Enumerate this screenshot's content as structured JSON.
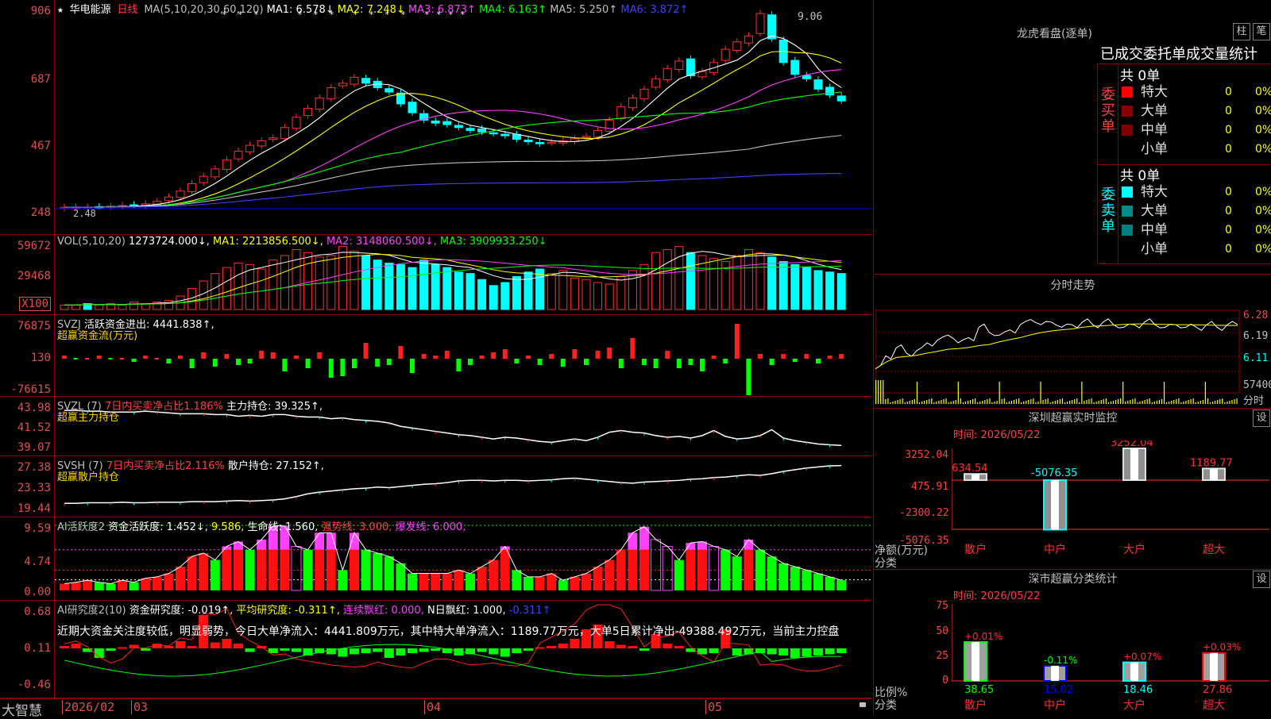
{
  "stock": {
    "star": "★",
    "name": "华电能源",
    "period": "日线"
  },
  "kline": {
    "ticks": [
      "906",
      "687",
      "467",
      "248"
    ],
    "ma_header": [
      {
        "t": "MA(5,10,20,30,60,120)",
        "c": "#c0c0c0"
      },
      {
        "t": "MA1: 6.578↓",
        "c": "#ffffff"
      },
      {
        "t": "MA2: 7.248↓",
        "c": "#ffff00"
      },
      {
        "t": "MA3: 6.873↑",
        "c": "#ff40ff"
      },
      {
        "t": "MA4: 6.163↑",
        "c": "#00ff00"
      },
      {
        "t": "MA5: 5.250↑",
        "c": "#c0c0c0"
      },
      {
        "t": "MA6: 3.872↑",
        "c": "#4040ff"
      }
    ],
    "high_label": "9.06",
    "low_label": "2.48",
    "closes": [
      2.5,
      2.51,
      2.5,
      2.52,
      2.54,
      2.56,
      2.58,
      2.62,
      2.7,
      2.85,
      3.05,
      3.3,
      3.55,
      3.8,
      4.1,
      4.4,
      4.6,
      4.75,
      4.85,
      5.2,
      5.55,
      5.85,
      6.2,
      6.55,
      6.7,
      6.9,
      6.7,
      6.55,
      6.4,
      6.0,
      5.7,
      5.45,
      5.35,
      5.3,
      5.2,
      5.1,
      5.05,
      5.0,
      4.92,
      4.8,
      4.72,
      4.65,
      4.7,
      4.75,
      4.82,
      4.9,
      5.1,
      5.45,
      5.9,
      6.2,
      6.5,
      6.85,
      7.2,
      7.45,
      6.95,
      7.1,
      7.4,
      7.85,
      8.1,
      8.3,
      9.06,
      8.2,
      7.4,
      7.0,
      6.85,
      6.5,
      6.3,
      6.1
    ]
  },
  "vol": {
    "ticks": [
      "59672",
      "29468",
      "X100"
    ],
    "header": [
      {
        "t": "VOL(5,10,20)",
        "c": "#c0c0c0"
      },
      {
        "t": "1273724.000↓,",
        "c": "#ffffff"
      },
      {
        "t": "MA1: 2213856.500↓,",
        "c": "#ffff00"
      },
      {
        "t": "MA2: 3148060.500↓,",
        "c": "#ff40ff"
      },
      {
        "t": "MA3: 3909933.250↓",
        "c": "#00ff00"
      }
    ],
    "values": [
      3,
      3,
      4,
      3,
      4,
      3,
      5,
      4,
      5,
      6,
      9,
      14,
      19,
      24,
      28,
      31,
      30,
      27,
      33,
      36,
      40,
      38,
      35,
      36,
      42,
      39,
      36,
      33,
      31,
      30,
      28,
      33,
      30,
      28,
      25,
      24,
      20,
      16,
      18,
      22,
      25,
      27,
      24,
      26,
      21,
      20,
      18,
      17,
      22,
      26,
      30,
      38,
      40,
      42,
      38,
      36,
      34,
      32,
      36,
      40,
      38,
      35,
      32,
      30,
      28,
      26,
      25,
      24
    ]
  },
  "svzj": {
    "ticks": [
      "76875",
      "130",
      "-76615"
    ],
    "header": [
      {
        "t": "SVZJ",
        "c": "#c0c0c0"
      },
      {
        "t": "活跃资金进出: 4441.838↑,",
        "c": "#ffffff"
      }
    ],
    "label2": "超赢资金流(万元)",
    "values": [
      2,
      -1,
      1,
      2,
      -1,
      1,
      -2,
      2,
      1,
      -3,
      2,
      -6,
      4,
      -5,
      3,
      -4,
      -3,
      5,
      4,
      -8,
      2,
      -6,
      4,
      -12,
      -11,
      -6,
      10,
      -5,
      -4,
      8,
      -9,
      3,
      2,
      5,
      -8,
      -4,
      2,
      4,
      6,
      -3,
      2,
      -4,
      3,
      -5,
      6,
      -4,
      5,
      7,
      -6,
      13,
      -4,
      -6,
      5,
      -6,
      -4,
      -8,
      2,
      -3,
      22,
      -24,
      3,
      -4,
      3,
      -2,
      3,
      -3,
      2,
      3
    ]
  },
  "svzl": {
    "ticks": [
      "43.98",
      "41.52",
      "39.07"
    ],
    "header": [
      {
        "t": "SVZL  (7)",
        "c": "#c0c0c0"
      },
      {
        "t": "7日内买卖净占比1.186%",
        "c": "#ff4040"
      },
      {
        "t": "主力持仓: 39.325↑,",
        "c": "#ffffff"
      }
    ],
    "label2": "超赢主力持仓",
    "values": [
      43.5,
      43.5,
      43.4,
      43.4,
      43.3,
      43.3,
      43.3,
      43.4,
      43.3,
      43.2,
      43.1,
      43.1,
      43.1,
      43.0,
      43.0,
      42.8,
      42.9,
      42.8,
      43.0,
      43.0,
      42.8,
      42.7,
      42.7,
      42.5,
      42.6,
      42.4,
      42.3,
      42.2,
      42.0,
      41.6,
      41.4,
      41.2,
      41.0,
      40.8,
      40.6,
      40.5,
      40.3,
      40.1,
      40.3,
      40.2,
      40.0,
      39.8,
      39.7,
      39.9,
      40.1,
      39.9,
      40.3,
      40.9,
      41.1,
      40.9,
      40.8,
      40.5,
      40.3,
      40.4,
      40.2,
      40.5,
      41.1,
      40.4,
      40.1,
      40.2,
      40.5,
      41.2,
      40.2,
      39.9,
      39.7,
      39.5,
      39.4,
      39.33
    ]
  },
  "svsh": {
    "ticks": [
      "27.38",
      "23.33",
      "19.44"
    ],
    "header": [
      {
        "t": "SVSH  (7)",
        "c": "#c0c0c0"
      },
      {
        "t": "7日内买卖净占比2.116%",
        "c": "#ff4040"
      },
      {
        "t": "散户持仓: 27.152↑,",
        "c": "#ffffff"
      }
    ],
    "label2": "超赢散户持仓",
    "values": [
      20.4,
      20.4,
      20.5,
      20.5,
      20.5,
      20.6,
      20.5,
      20.5,
      20.6,
      20.6,
      20.6,
      20.7,
      20.7,
      20.7,
      20.8,
      20.9,
      20.8,
      20.9,
      21.0,
      21.2,
      21.6,
      22.1,
      22.4,
      22.6,
      22.8,
      23.0,
      23.1,
      23.3,
      23.2,
      23.4,
      23.6,
      23.8,
      23.9,
      24.1,
      24.4,
      24.5,
      24.5,
      24.4,
      24.5,
      24.5,
      24.4,
      24.5,
      24.6,
      24.8,
      24.9,
      24.7,
      24.5,
      24.3,
      24.1,
      24.0,
      24.2,
      24.3,
      24.4,
      24.5,
      24.7,
      24.8,
      25.0,
      25.1,
      25.3,
      25.5,
      25.4,
      25.7,
      26.1,
      26.4,
      26.7,
      26.9,
      27.1,
      27.15
    ]
  },
  "ai1": {
    "ticks": [
      "9.59",
      "4.74",
      "0.00"
    ],
    "header": [
      {
        "t": "AI活跃度2",
        "c": "#c0c0c0"
      },
      {
        "t": "资金活跃度: 1.452↓,",
        "c": "#ffffff"
      },
      {
        "t": "9.586,",
        "c": "#ffff00"
      },
      {
        "t": "生命线: 1.560,",
        "c": "#ffffff"
      },
      {
        "t": "强势线: 3.000,",
        "c": "#ff4040"
      },
      {
        "t": "爆发线: 6.000,",
        "c": "#ff40ff"
      }
    ],
    "values": [
      1,
      1.2,
      1.5,
      1.2,
      1,
      1.5,
      1.2,
      1.8,
      2,
      2.5,
      3.5,
      5,
      5.5,
      4.5,
      6.5,
      7.2,
      6,
      7.5,
      9.5,
      9.5,
      6.5,
      6,
      8.5,
      8.5,
      3,
      8.5,
      6,
      5.5,
      5,
      4,
      2.5,
      2.5,
      2.5,
      2.5,
      3,
      2.5,
      3.5,
      4.5,
      6.5,
      3,
      2,
      2,
      2.5,
      1.5,
      2,
      2.5,
      3.5,
      4.5,
      6,
      8.5,
      9.4,
      7.5,
      6.5,
      4.5,
      7,
      7.2,
      6.5,
      6,
      5,
      7.5,
      6,
      5,
      4,
      3.5,
      3,
      2.5,
      2,
      1.5
    ]
  },
  "ai2": {
    "ticks": [
      "0.68",
      "0.11",
      "-0.46"
    ],
    "header": [
      {
        "t": "AI研究度2(10)",
        "c": "#c0c0c0"
      },
      {
        "t": "资金研究度: -0.019↑,",
        "c": "#ffffff"
      },
      {
        "t": "平均研究度: -0.311↑,",
        "c": "#ffff00"
      },
      {
        "t": "连续飘红: 0.000,",
        "c": "#ff40ff"
      },
      {
        "t": "N日飘红: 1.000,",
        "c": "#ffffff"
      },
      {
        "t": "-0.311↑",
        "c": "#4040ff"
      }
    ],
    "note": "近期大资金关注度较低，明显弱势，今日大单净流入：4441.809万元，其中特大单净流入：1189.77万元，大单5日累计净出-49388.492万元，当前主力控盘",
    "values": [
      0.02,
      0.04,
      -0.03,
      -0.08,
      -0.02,
      0.01,
      0.03,
      -0.02,
      0.04,
      0.02,
      0.06,
      0.02,
      0.28,
      0.05,
      0.08,
      0.04,
      -0.03,
      0.02,
      -0.04,
      -0.02,
      -0.03,
      -0.06,
      -0.04,
      -0.05,
      -0.07,
      -0.05,
      -0.04,
      -0.03,
      -0.08,
      -0.06,
      -0.04,
      -0.03,
      -0.02,
      -0.04,
      -0.06,
      -0.05,
      -0.03,
      -0.05,
      -0.07,
      -0.04,
      -0.02,
      0.01,
      0.02,
      0.04,
      0.08,
      0.16,
      0.2,
      0.06,
      0.03,
      0.02,
      -0.02,
      0.12,
      0.04,
      0.02,
      -0.03,
      -0.05,
      -0.04,
      0.16,
      -0.06,
      -0.05,
      -0.04,
      -0.05,
      -0.06,
      -0.08,
      -0.07,
      -0.06,
      -0.05,
      -0.04
    ]
  },
  "dates": {
    "year_month": "2026/02",
    "m1": "03",
    "m2": "04",
    "m3": "05"
  },
  "brand": "大智慧",
  "lhb": {
    "title": "龙虎看盘(逐单)",
    "btn1": "柱",
    "btn2": "笔",
    "subtitle": "已成交委托单成交量统计",
    "buy": {
      "label": "委买单",
      "total": "共 0单",
      "rows": [
        {
          "name": "特大",
          "a": "0",
          "b": "0%",
          "c": "#ff0000"
        },
        {
          "name": "大单",
          "a": "0",
          "b": "0%",
          "c": "#8b0000"
        },
        {
          "name": "中单",
          "a": "0",
          "b": "0%",
          "c": "#800000"
        },
        {
          "name": "小单",
          "a": "0",
          "b": "0%",
          "c": "#000000"
        }
      ]
    },
    "sell": {
      "label": "委卖单",
      "total": "共 0单",
      "rows": [
        {
          "name": "特大",
          "a": "0",
          "b": "0%",
          "c": "#00ffff"
        },
        {
          "name": "大单",
          "a": "0",
          "b": "0%",
          "c": "#008b8b"
        },
        {
          "name": "中单",
          "a": "0",
          "b": "0%",
          "c": "#008080"
        },
        {
          "name": "小单",
          "a": "0",
          "b": "0%",
          "c": "#000000"
        }
      ]
    }
  },
  "fenshi": {
    "title": "分时走势",
    "ticks": [
      "6.28",
      "6.19",
      "6.11"
    ],
    "vol_label": "57400",
    "vol_unit": "分时",
    "prices": [
      6.1,
      6.15,
      6.18,
      6.16,
      6.17,
      6.2,
      6.21,
      6.23,
      6.2,
      6.22,
      6.26,
      6.24,
      6.23,
      6.25,
      6.27,
      6.29,
      6.27,
      6.28,
      6.26,
      6.27,
      6.28,
      6.27,
      6.28,
      6.27,
      6.26,
      6.27,
      6.28,
      6.27,
      6.26,
      6.27,
      6.26,
      6.26,
      6.27,
      6.26,
      6.27,
      6.27
    ]
  },
  "monitor": {
    "title": "深圳超赢实时监控",
    "btn": "设",
    "time": "时间: 2026/05/22",
    "ticks": [
      "3252.04",
      "475.91",
      "-2300.22",
      "-5076.35"
    ],
    "ylabel": "净额(万元)",
    "xlabel": "分类",
    "cats": [
      {
        "name": "散户",
        "v": 634.54,
        "label": "634.54"
      },
      {
        "name": "中户",
        "v": -5076.35,
        "label": "-5076.35"
      },
      {
        "name": "大户",
        "v": 3252.04,
        "label": "3252.04"
      },
      {
        "name": "超大",
        "v": 1189.77,
        "label": "1189.77"
      }
    ]
  },
  "classify": {
    "title": "深市超赢分类统计",
    "btn": "设",
    "time": "时间: 2026/05/22",
    "ticks": [
      "75",
      "50",
      "25",
      "0"
    ],
    "ylabel": "比例%",
    "xlabel": "分类",
    "cats": [
      {
        "name": "散户",
        "v": 38.65,
        "pct": "+0.01%",
        "val": "38.65",
        "c": "#00ff00"
      },
      {
        "name": "中户",
        "v": 15.02,
        "pct": "-0.11%",
        "val": "15.02",
        "c": "#0000ff"
      },
      {
        "name": "大户",
        "v": 18.46,
        "pct": "+0.07%",
        "val": "18.46",
        "c": "#00ffff"
      },
      {
        "name": "超大",
        "v": 27.86,
        "pct": "+0.03%",
        "val": "27.86",
        "c": "#ff0000"
      }
    ]
  }
}
